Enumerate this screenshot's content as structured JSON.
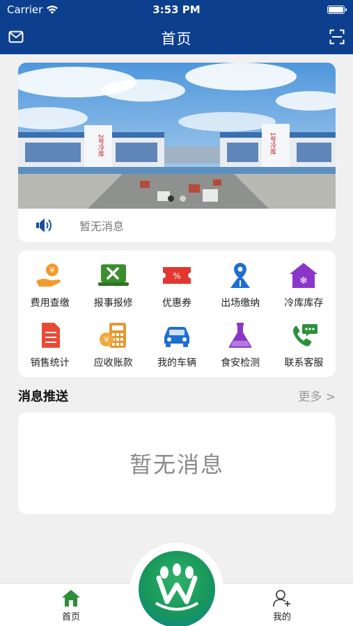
{
  "status_bar": {
    "carrier": "Carrier",
    "time": "3:53 PM"
  },
  "nav": {
    "title": "首页",
    "left_icon": "mail-icon",
    "right_icon": "scan-icon"
  },
  "banner": {
    "slides": 2,
    "active_slide": 1,
    "signs": [
      "2号冷库",
      "1号冷库"
    ]
  },
  "notice": {
    "icon": "speaker-icon",
    "text": "暂无消息"
  },
  "grid": [
    {
      "label": "费用查缴",
      "icon": "payment-hand-icon"
    },
    {
      "label": "报事报修",
      "icon": "repair-tools-icon"
    },
    {
      "label": "优惠券",
      "icon": "coupon-icon"
    },
    {
      "label": "出场缴纳",
      "icon": "exit-location-icon"
    },
    {
      "label": "冷库库存",
      "icon": "cold-storage-icon"
    },
    {
      "label": "销售统计",
      "icon": "sales-report-icon"
    },
    {
      "label": "应收账款",
      "icon": "receivable-calculator-icon"
    },
    {
      "label": "我的车辆",
      "icon": "car-icon"
    },
    {
      "label": "食安检测",
      "icon": "flask-icon"
    },
    {
      "label": "联系客服",
      "icon": "customer-service-phone-icon"
    }
  ],
  "messages": {
    "title": "消息推送",
    "more": "更多 >",
    "empty_text": "暂无消息"
  },
  "tabbar": {
    "home": "首页",
    "me": "我的"
  },
  "colors": {
    "nav_bg": "#0d3f8f",
    "tab_active": "#2d8f3a",
    "logo_green": "#17975a"
  }
}
